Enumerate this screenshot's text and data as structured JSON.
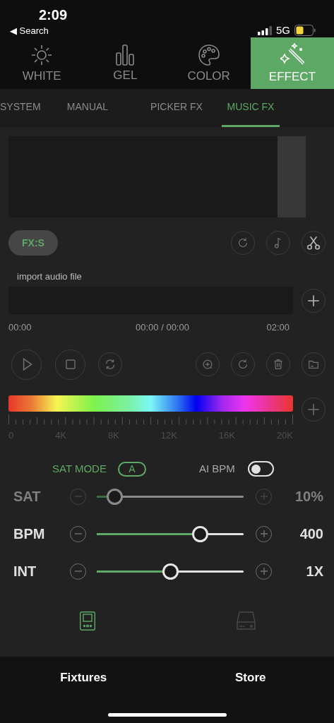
{
  "status_bar": {
    "time": "2:09",
    "back_label": "◀ Search",
    "network": "5G"
  },
  "category_tabs": [
    {
      "label": "WHITE",
      "selected": false
    },
    {
      "label": "GEL",
      "selected": false
    },
    {
      "label": "COLOR",
      "selected": false
    },
    {
      "label": "EFFECT",
      "selected": true
    }
  ],
  "sub_tabs": [
    {
      "label": "SYSTEM",
      "selected": false
    },
    {
      "label": "MANUAL",
      "selected": false
    },
    {
      "label": "PICKER FX",
      "selected": false
    },
    {
      "label": "MUSIC FX",
      "selected": true
    }
  ],
  "fx_button": "FX:S",
  "audio": {
    "label": "import audio file",
    "start": "00:00",
    "position": "00:00 / 00:00",
    "end": "02:00"
  },
  "frequency_labels": [
    "0",
    "4K",
    "8K",
    "12K",
    "16K",
    "20K"
  ],
  "sat_mode": {
    "label": "SAT MODE",
    "value": "A"
  },
  "ai_bpm": {
    "label": "AI BPM",
    "on": false
  },
  "sliders": [
    {
      "label": "SAT",
      "reading": "10%",
      "level": 0.12,
      "disabled": true
    },
    {
      "label": "BPM",
      "reading": "400",
      "level": 0.7,
      "disabled": false
    },
    {
      "label": "INT",
      "reading": "1X",
      "level": 0.5,
      "disabled": false
    }
  ],
  "device_tabs": [
    {
      "selected": true
    },
    {
      "selected": false
    }
  ],
  "bottom_nav": [
    "Fixtures",
    "Store"
  ]
}
